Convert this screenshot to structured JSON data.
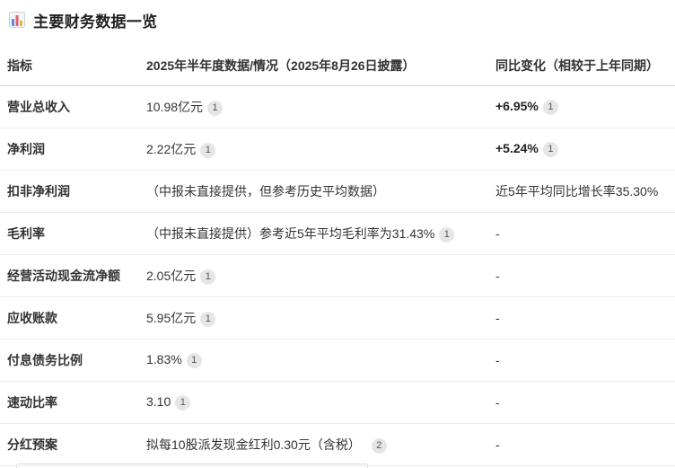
{
  "heading": {
    "icon": "bar-chart-icon",
    "title": "主要财务数据一览"
  },
  "table": {
    "headers": [
      "指标",
      "2025年半年度数据/情况（2025年8月26日披露）",
      "同比变化（相较于上年同期）"
    ],
    "rows": [
      {
        "metric": "营业总收入",
        "value": "10.98亿元",
        "value_ref": "1",
        "change": "+6.95%",
        "change_ref": "1"
      },
      {
        "metric": "净利润",
        "value": "2.22亿元",
        "value_ref": "1",
        "change": "+5.24%",
        "change_ref": "1"
      },
      {
        "metric": "扣非净利润",
        "value": "（中报未直接提供，但参考历史平均数据）",
        "value_ref": "",
        "change": "近5年平均同比增长率35.30%",
        "change_ref": ""
      },
      {
        "metric": "毛利率",
        "value": "（中报未直接提供）参考近5年平均毛利率为31.43%",
        "value_ref": "1",
        "change": "-",
        "change_ref": ""
      },
      {
        "metric": "经营活动现金流净额",
        "value": "2.05亿元",
        "value_ref": "1",
        "change": "-",
        "change_ref": ""
      },
      {
        "metric": "应收账款",
        "value": "5.95亿元",
        "value_ref": "1",
        "change": "-",
        "change_ref": ""
      },
      {
        "metric": "付息债务比例",
        "value": "1.83%",
        "value_ref": "1",
        "change": "-",
        "change_ref": ""
      },
      {
        "metric": "速动比率",
        "value": "3.10",
        "value_ref": "1",
        "change": "-",
        "change_ref": ""
      },
      {
        "metric": "分红预案",
        "value": "拟每10股派发现金红利0.30元（含税）",
        "value_ref": "2",
        "change": "-",
        "change_ref": ""
      }
    ]
  },
  "colors": {
    "icon_bars": [
      "#4f8fe8",
      "#e85d75",
      "#f2b233"
    ],
    "ref_badge_bg": "#e6e6e6",
    "header_rule": "#d8d8d8",
    "row_rule": "#ececec"
  }
}
